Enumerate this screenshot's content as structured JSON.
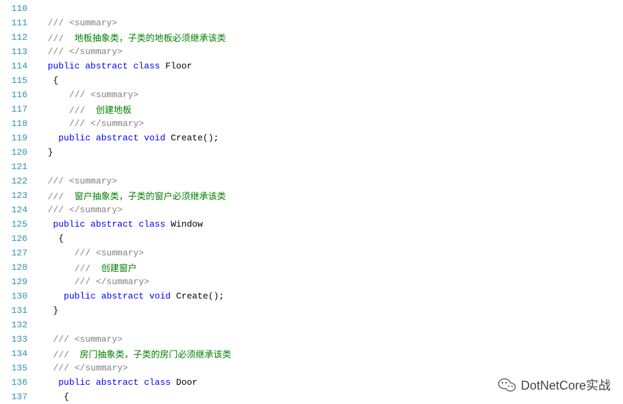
{
  "watermark": {
    "text": "DotNetCore实战"
  },
  "lines": [
    {
      "n": 110,
      "indent": 0,
      "tokens": []
    },
    {
      "n": 111,
      "indent": 2,
      "tokens": [
        {
          "t": "///",
          "c": "comment-gray"
        },
        {
          "t": " ",
          "c": "plain"
        },
        {
          "t": "<summary>",
          "c": "comment-gray"
        }
      ]
    },
    {
      "n": 112,
      "indent": 2,
      "tokens": [
        {
          "t": "///",
          "c": "comment-gray"
        },
        {
          "t": "  ",
          "c": "plain"
        },
        {
          "t": "地板抽象类，子类的地板必须继承该类",
          "c": "comment"
        }
      ]
    },
    {
      "n": 113,
      "indent": 2,
      "tokens": [
        {
          "t": "///",
          "c": "comment-gray"
        },
        {
          "t": " ",
          "c": "plain"
        },
        {
          "t": "</summary>",
          "c": "comment-gray"
        }
      ]
    },
    {
      "n": 114,
      "indent": 2,
      "tokens": [
        {
          "t": "public",
          "c": "keyword"
        },
        {
          "t": " ",
          "c": "plain"
        },
        {
          "t": "abstract",
          "c": "keyword"
        },
        {
          "t": " ",
          "c": "plain"
        },
        {
          "t": "class",
          "c": "keyword"
        },
        {
          "t": " Floor",
          "c": "plain"
        }
      ]
    },
    {
      "n": 115,
      "indent": 3,
      "tokens": [
        {
          "t": "{",
          "c": "plain"
        }
      ]
    },
    {
      "n": 116,
      "indent": 6,
      "tokens": [
        {
          "t": "///",
          "c": "comment-gray"
        },
        {
          "t": " ",
          "c": "plain"
        },
        {
          "t": "<summary>",
          "c": "comment-gray"
        }
      ]
    },
    {
      "n": 117,
      "indent": 6,
      "tokens": [
        {
          "t": "///",
          "c": "comment-gray"
        },
        {
          "t": "  ",
          "c": "plain"
        },
        {
          "t": "创建地板",
          "c": "comment"
        }
      ]
    },
    {
      "n": 118,
      "indent": 6,
      "tokens": [
        {
          "t": "///",
          "c": "comment-gray"
        },
        {
          "t": " ",
          "c": "plain"
        },
        {
          "t": "</summary>",
          "c": "comment-gray"
        }
      ]
    },
    {
      "n": 119,
      "indent": 4,
      "tokens": [
        {
          "t": "public",
          "c": "keyword"
        },
        {
          "t": " ",
          "c": "plain"
        },
        {
          "t": "abstract",
          "c": "keyword"
        },
        {
          "t": " ",
          "c": "plain"
        },
        {
          "t": "void",
          "c": "keyword"
        },
        {
          "t": " Create();",
          "c": "plain"
        }
      ]
    },
    {
      "n": 120,
      "indent": 2,
      "tokens": [
        {
          "t": "}",
          "c": "plain"
        }
      ]
    },
    {
      "n": 121,
      "indent": 0,
      "tokens": []
    },
    {
      "n": 122,
      "indent": 2,
      "tokens": [
        {
          "t": "///",
          "c": "comment-gray"
        },
        {
          "t": " ",
          "c": "plain"
        },
        {
          "t": "<summary>",
          "c": "comment-gray"
        }
      ]
    },
    {
      "n": 123,
      "indent": 2,
      "tokens": [
        {
          "t": "///",
          "c": "comment-gray"
        },
        {
          "t": "  ",
          "c": "plain"
        },
        {
          "t": "窗户抽象类，子类的窗户必须继承该类",
          "c": "comment"
        }
      ]
    },
    {
      "n": 124,
      "indent": 2,
      "tokens": [
        {
          "t": "///",
          "c": "comment-gray"
        },
        {
          "t": " ",
          "c": "plain"
        },
        {
          "t": "</summary>",
          "c": "comment-gray"
        }
      ]
    },
    {
      "n": 125,
      "indent": 3,
      "tokens": [
        {
          "t": "public",
          "c": "keyword"
        },
        {
          "t": " ",
          "c": "plain"
        },
        {
          "t": "abstract",
          "c": "keyword"
        },
        {
          "t": " ",
          "c": "plain"
        },
        {
          "t": "class",
          "c": "keyword"
        },
        {
          "t": " Window",
          "c": "plain"
        }
      ]
    },
    {
      "n": 126,
      "indent": 4,
      "tokens": [
        {
          "t": "{",
          "c": "plain"
        }
      ]
    },
    {
      "n": 127,
      "indent": 7,
      "tokens": [
        {
          "t": "///",
          "c": "comment-gray"
        },
        {
          "t": " ",
          "c": "plain"
        },
        {
          "t": "<summary>",
          "c": "comment-gray"
        }
      ]
    },
    {
      "n": 128,
      "indent": 7,
      "tokens": [
        {
          "t": "///",
          "c": "comment-gray"
        },
        {
          "t": "  ",
          "c": "plain"
        },
        {
          "t": "创建窗户",
          "c": "comment"
        }
      ]
    },
    {
      "n": 129,
      "indent": 7,
      "tokens": [
        {
          "t": "///",
          "c": "comment-gray"
        },
        {
          "t": " ",
          "c": "plain"
        },
        {
          "t": "</summary>",
          "c": "comment-gray"
        }
      ]
    },
    {
      "n": 130,
      "indent": 5,
      "tokens": [
        {
          "t": "public",
          "c": "keyword"
        },
        {
          "t": " ",
          "c": "plain"
        },
        {
          "t": "abstract",
          "c": "keyword"
        },
        {
          "t": " ",
          "c": "plain"
        },
        {
          "t": "void",
          "c": "keyword"
        },
        {
          "t": " Create();",
          "c": "plain"
        }
      ]
    },
    {
      "n": 131,
      "indent": 3,
      "tokens": [
        {
          "t": "}",
          "c": "plain"
        }
      ]
    },
    {
      "n": 132,
      "indent": 0,
      "tokens": []
    },
    {
      "n": 133,
      "indent": 3,
      "tokens": [
        {
          "t": "///",
          "c": "comment-gray"
        },
        {
          "t": " ",
          "c": "plain"
        },
        {
          "t": "<summary>",
          "c": "comment-gray"
        }
      ]
    },
    {
      "n": 134,
      "indent": 3,
      "tokens": [
        {
          "t": "///",
          "c": "comment-gray"
        },
        {
          "t": "  ",
          "c": "plain"
        },
        {
          "t": "房门抽象类，子类的房门必须继承该类",
          "c": "comment"
        }
      ]
    },
    {
      "n": 135,
      "indent": 3,
      "tokens": [
        {
          "t": "///",
          "c": "comment-gray"
        },
        {
          "t": " ",
          "c": "plain"
        },
        {
          "t": "</summary>",
          "c": "comment-gray"
        }
      ]
    },
    {
      "n": 136,
      "indent": 4,
      "tokens": [
        {
          "t": "public",
          "c": "keyword"
        },
        {
          "t": " ",
          "c": "plain"
        },
        {
          "t": "abstract",
          "c": "keyword"
        },
        {
          "t": " ",
          "c": "plain"
        },
        {
          "t": "class",
          "c": "keyword"
        },
        {
          "t": " Door",
          "c": "plain"
        }
      ]
    },
    {
      "n": 137,
      "indent": 5,
      "tokens": [
        {
          "t": "{",
          "c": "plain"
        }
      ]
    }
  ]
}
